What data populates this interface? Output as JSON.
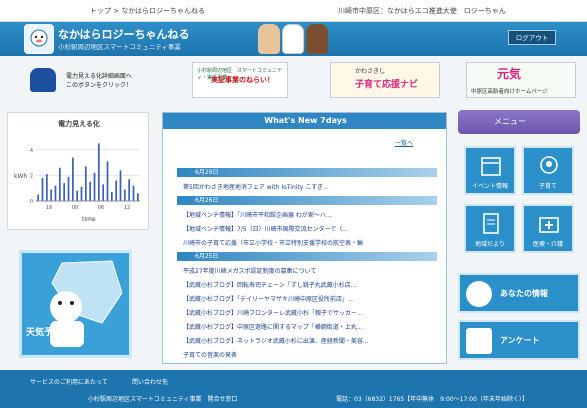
{
  "topbar": {
    "breadcrumb": "トップ > なかはらロジーちゃんねる",
    "user_info": "川崎市中原区：なかはらエコ推進大使　ロジーちゃん"
  },
  "header": {
    "title": "なかはらロジーちゃんねる",
    "subtitle": "小杉駅周辺地区スマートコミュニティ事業",
    "logout_label": "ログアウト"
  },
  "banners": {
    "visualize_text": "電力見える化詳細画面へ\nこのボタンをクリック！",
    "demo_top": "小杉駅周辺地区　スマートコミュニティ・実証事業",
    "demo_main": "実証事業のねらい！",
    "kosodate_top": "かわさきし",
    "kosodate_main": "子育て応援ナビ",
    "genki_main": "元気",
    "genki_sub": "中原区高齢者向けホームページ"
  },
  "chart": {
    "title": "電力見える化",
    "ylabel": "kWh",
    "xlabel": "time"
  },
  "chart_data": {
    "type": "bar",
    "title": "電力見える化",
    "xlabel": "time",
    "ylabel": "kWh",
    "x_ticks": [
      "18",
      "00",
      "06",
      "12"
    ],
    "y_ticks": [
      "0",
      "2",
      "4"
    ],
    "ylim": [
      0,
      5
    ],
    "values": [
      0.5,
      1.8,
      2.1,
      0.9,
      1.2,
      2.6,
      1.4,
      1.9,
      3.4,
      0.8,
      1.1,
      2.7,
      1.5,
      2.2,
      4.5,
      1.3,
      3.1,
      0.7,
      1.6,
      2.4,
      0.9,
      1.7,
      1.2,
      0.6
    ]
  },
  "weather": {
    "label": "天気予報"
  },
  "news": {
    "heading": "What's New 7days",
    "list_link": "一覧へ",
    "dates": [
      "6月29日",
      "6月26日",
      "6月25日"
    ],
    "items": [
      "第5回かわさき地産地消フェア with IoTinity こすぎ...",
      "【地域ベンチ情報】「川崎市平和館企画展 わが家〜ハ...",
      "【地域ベンチ情報】7/5（日）川崎市国際交流センターで（...",
      "川崎市の子育て応援（市立小学校・市立特別支援学校の航空表・輪",
      "平成27年度川崎メガスポ認証制度の募集について",
      "【武蔵小杉ブログ】回転寿司チェーン「すし銚子丸武蔵小杉店...",
      "【武蔵小杉ブログ】「デイリーヤマザキ川崎中原区役所前店」...",
      "【武蔵小杉ブログ】川崎フロンターレ武蔵小杉「親子でサッカー...",
      "【武蔵小杉ブログ】中原区遊路に関するマップ「横綱街道・上丸...",
      "【武蔵小杉ブログ】ネットラジオ武蔵小杉に出演、産経新聞・美容...",
      "子育ての音楽の発表"
    ]
  },
  "menu": {
    "heading": "メニュー",
    "tiles": [
      "イベント情報",
      "子育て",
      "地域だより",
      "医療・介護"
    ],
    "your_info": "あなたの情報",
    "survey": "アンケート"
  },
  "footer": {
    "notice": "サービスのご利用にあたって",
    "contact": "問い合わせ先",
    "org": "小杉駅周辺地区スマートコミュニティ事業　開合せ窓口",
    "phone": "電話：03（6832）1765【年中無休　9:00〜17:00（年末年始除く）】"
  }
}
